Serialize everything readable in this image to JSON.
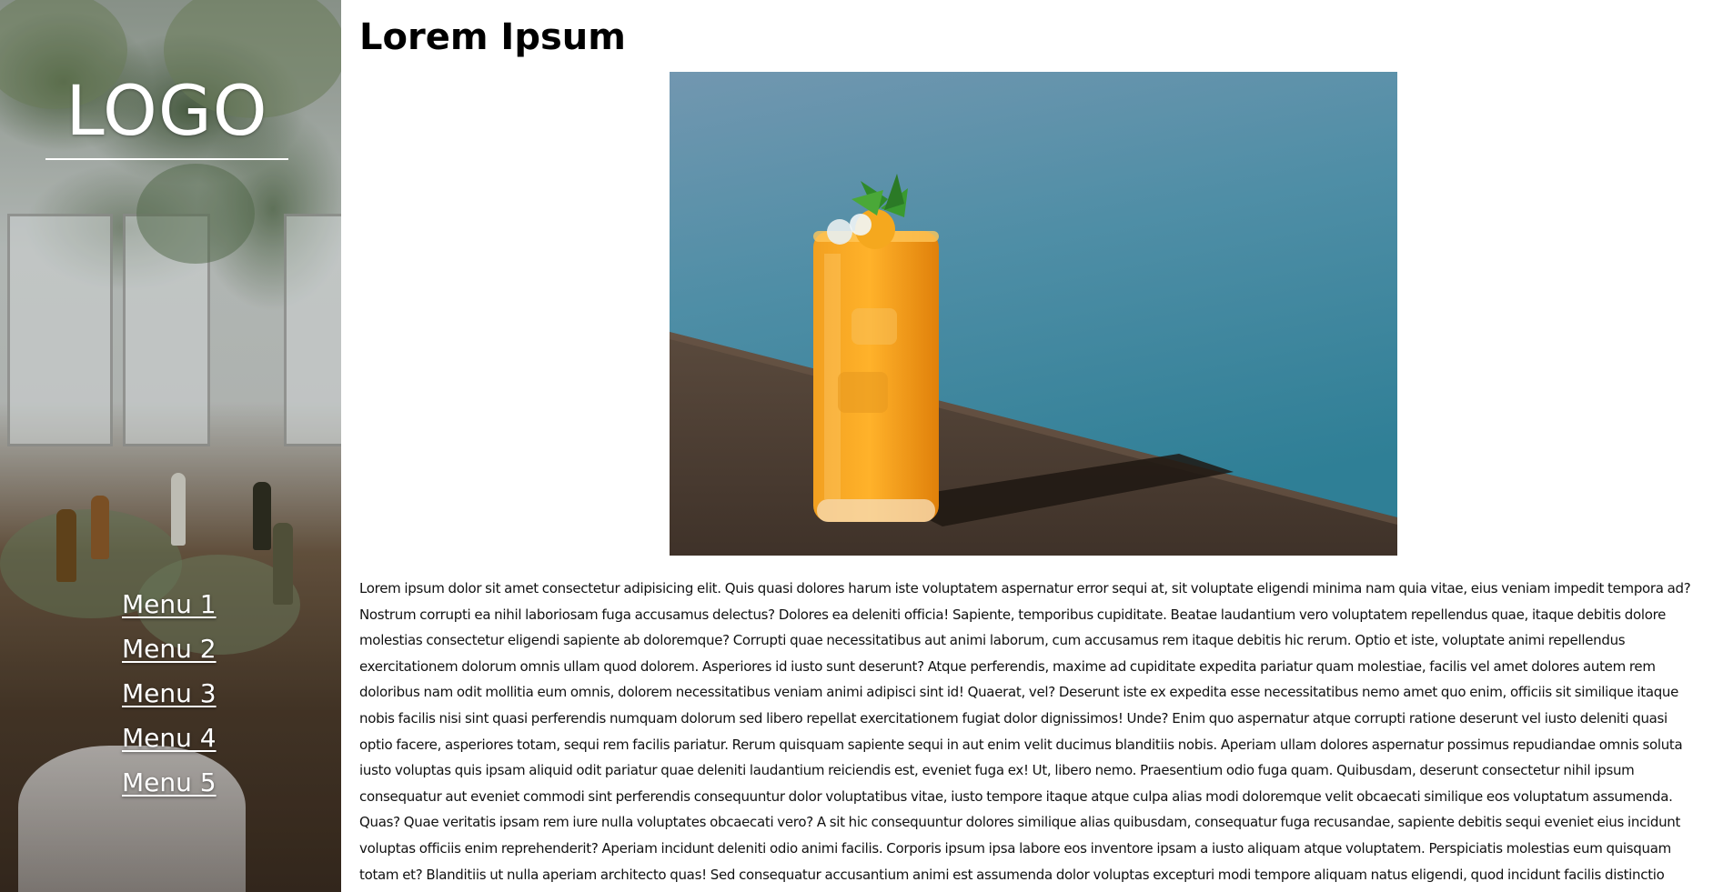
{
  "sidebar": {
    "logo": "LOGO",
    "menu": [
      {
        "label": "Menu 1"
      },
      {
        "label": "Menu 2"
      },
      {
        "label": "Menu 3"
      },
      {
        "label": "Menu 4"
      },
      {
        "label": "Menu 5"
      }
    ],
    "text_color": "#ffffff"
  },
  "main": {
    "title": "Lorem Ipsum",
    "hero_image": {
      "icon": "cocktail-photo",
      "colors": {
        "water": "#4f8ea6",
        "deck": "#4a3b30",
        "drink": "#f59a12"
      }
    },
    "body": "Lorem ipsum dolor sit amet consectetur adipisicing elit. Quis quasi dolores harum iste voluptatem aspernatur error sequi at, sit voluptate eligendi minima nam quia vitae, eius veniam impedit tempora ad? Nostrum corrupti ea nihil laboriosam fuga accusamus delectus? Dolores ea deleniti officia! Sapiente, temporibus cupiditate. Beatae laudantium vero voluptatem repellendus quae, itaque debitis dolore molestias consectetur eligendi sapiente ab doloremque? Corrupti quae necessitatibus aut animi laborum, cum accusamus rem itaque debitis hic rerum. Optio et iste, voluptate animi repellendus exercitationem dolorum omnis ullam quod dolorem. Asperiores id iusto sunt deserunt? Atque perferendis, maxime ad cupiditate expedita pariatur quam molestiae, facilis vel amet dolores autem rem doloribus nam odit mollitia eum omnis, dolorem necessitatibus veniam animi adipisci sint id! Quaerat, vel? Deserunt iste ex expedita esse necessitatibus nemo amet quo enim, officiis sit similique itaque nobis facilis nisi sint quasi perferendis numquam dolorum sed libero repellat exercitationem fugiat dolor dignissimos! Unde? Enim quo aspernatur atque corrupti ratione deserunt vel iusto deleniti quasi optio facere, asperiores totam, sequi rem facilis pariatur. Rerum quisquam sapiente sequi in aut enim velit ducimus blanditiis nobis. Aperiam ullam dolores aspernatur possimus repudiandae omnis soluta iusto voluptas quis ipsam aliquid odit pariatur quae deleniti laudantium reiciendis est, eveniet fuga ex! Ut, libero nemo. Praesentium odio fuga quam. Quibusdam, deserunt consectetur nihil ipsum consequatur aut eveniet commodi sint perferendis consequuntur dolor voluptatibus vitae, iusto tempore itaque atque culpa alias modi doloremque velit obcaecati similique eos voluptatum assumenda. Quas? Quae veritatis ipsam rem iure nulla voluptates obcaecati vero? A sit hic consequuntur dolores similique alias quibusdam, consequatur fuga recusandae, sapiente debitis sequi eveniet eius incidunt voluptas officiis enim reprehenderit? Aperiam incidunt deleniti odio animi facilis. Corporis ipsum ipsa labore eos inventore ipsam a iusto aliquam atque voluptatem. Perspiciatis molestias eum quisquam totam et? Blanditiis ut nulla aperiam architecto quas! Sed consequatur accusantium animi est assumenda dolor voluptas excepturi modi tempore aliquam natus eligendi, quod incidunt facilis distinctio"
  }
}
